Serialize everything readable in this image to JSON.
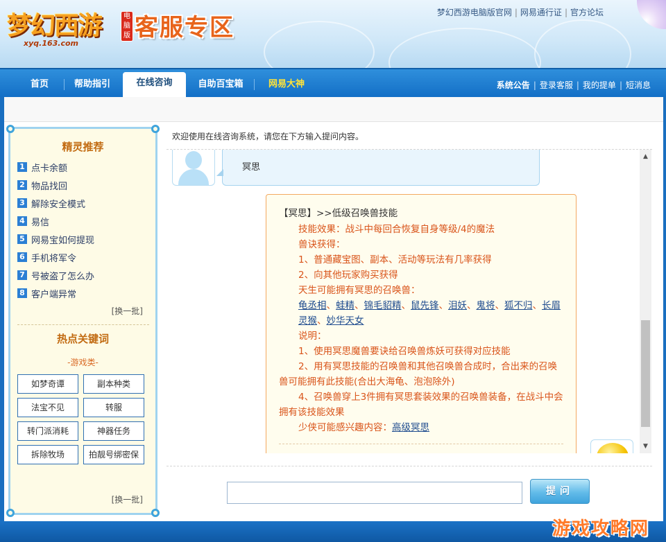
{
  "header": {
    "logo_text": "梦幻西游",
    "logo_badge": "电脑版",
    "logo_url": "xyq.163.com",
    "zone_title": "客服专区",
    "top_links": [
      "梦幻西游电脑版官网",
      "网易通行证",
      "官方论坛"
    ]
  },
  "nav": {
    "tabs": [
      "首页",
      "帮助指引",
      "在线咨询",
      "自助百宝箱",
      "网易大神"
    ],
    "active_tab": "在线咨询",
    "right_links": [
      "系统公告",
      "登录客服",
      "我的提单",
      "短消息"
    ]
  },
  "sidebar": {
    "sprite_title": "精灵推荐",
    "sprite_items": [
      {
        "num": "1",
        "label": "点卡余额"
      },
      {
        "num": "2",
        "label": "物品找回"
      },
      {
        "num": "3",
        "label": "解除安全模式"
      },
      {
        "num": "4",
        "label": "易信"
      },
      {
        "num": "5",
        "label": "网易宝如何提现"
      },
      {
        "num": "6",
        "label": "手机将军令"
      },
      {
        "num": "7",
        "label": "号被盗了怎么办"
      },
      {
        "num": "8",
        "label": "客户端异常"
      }
    ],
    "refresh_label": "[换一批]",
    "hot_title": "热点关键词",
    "category_label": "-游戏类-",
    "keywords": [
      "如梦奇谭",
      "副本种类",
      "法宝不见",
      "转服",
      "转门派消耗",
      "神器任务",
      "拆除牧场",
      "拍靓号绑密保"
    ],
    "refresh_label_2": "[换一批]"
  },
  "chat": {
    "welcome": "欢迎使用在线咨询系统，请您在下方输入提问内容。",
    "user_message": "冥思",
    "reply": {
      "heading": "【冥思】>>低级召唤兽技能",
      "effect": "技能效果：战斗中每回合恢复自身等级/4的魔法",
      "obtain_title": "兽诀获得：",
      "obtain_1": "1、普通藏宝图、副本、活动等玩法有几率获得",
      "obtain_2": "2、向其他玩家购买获得",
      "natural_title": "天生可能拥有冥思的召唤兽：",
      "pets": [
        "龟丞相",
        "蛙精",
        "锦毛貂精",
        "鼠先锋",
        "泪妖",
        "鬼将",
        "狐不归",
        "长眉灵猴",
        "妙华天女"
      ],
      "note_title": "说明：",
      "note_1": "1、使用冥思魔兽要诀给召唤兽炼妖可获得对应技能",
      "note_2": "2、用有冥思技能的召唤兽和其他召唤兽合成时，合出来的召唤兽可能拥有此技能(合出大海龟、泡泡除外)",
      "note_4": "4、召唤兽穿上3件拥有冥思套装效果的召唤兽装备，在战斗中会拥有该技能效果",
      "interest_label": "少侠可能感兴趣内容：",
      "interest_link": "高级冥思"
    },
    "input_placeholder": "",
    "ask_button": "提问"
  },
  "watermark": "游戏攻略网",
  "colors": {
    "nav_blue": "#136fc6",
    "accent_orange": "#d9541a",
    "link_blue": "#1f4c8f",
    "sidebar_bg": "#fefbe6"
  }
}
